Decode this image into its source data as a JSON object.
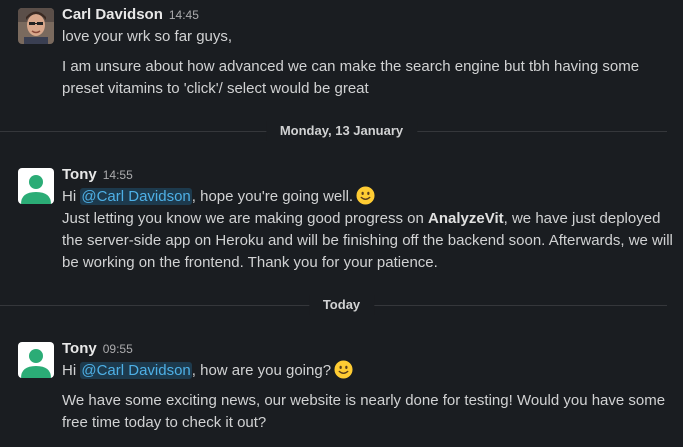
{
  "messages": [
    {
      "author": "Carl Davidson",
      "time": "14:45",
      "lines": [
        "love your wrk so far guys,",
        "I am unsure about how advanced we can make the search engine but tbh having some",
        "preset vitamins to 'click'/ select would be great"
      ]
    },
    {
      "author": "Tony",
      "time": "14:55",
      "greeting": "Hi",
      "mention": "@Carl Davidson",
      "after_mention": ", hope you're going well.",
      "line2_before": "Just letting you know we are making good progress on ",
      "line2_bold": "AnalyzeVit",
      "line2_after": ", we have just deployed",
      "line3": "the server-side app on Heroku and will be finishing off the backend soon. Afterwards, we will",
      "line4": "be working on the frontend. Thank you for your patience."
    },
    {
      "author": "Tony",
      "time": "09:55",
      "greeting": "Hi",
      "mention": "@Carl Davidson",
      "after_mention": ", how are you going?",
      "line2": "We have some exciting news, our website is nearly done for testing! Would you have some",
      "line3": "free time today to check it out?"
    }
  ],
  "dividers": {
    "first": "Monday, 13 January",
    "second": "Today"
  },
  "icons": {
    "emoji": "slightly-smiling-face-icon",
    "default_avatar": "default-user-avatar-icon"
  },
  "colors": {
    "background": "#1a1d21",
    "mention": "#4eb0e6",
    "avatar_green": "#2bac76"
  }
}
